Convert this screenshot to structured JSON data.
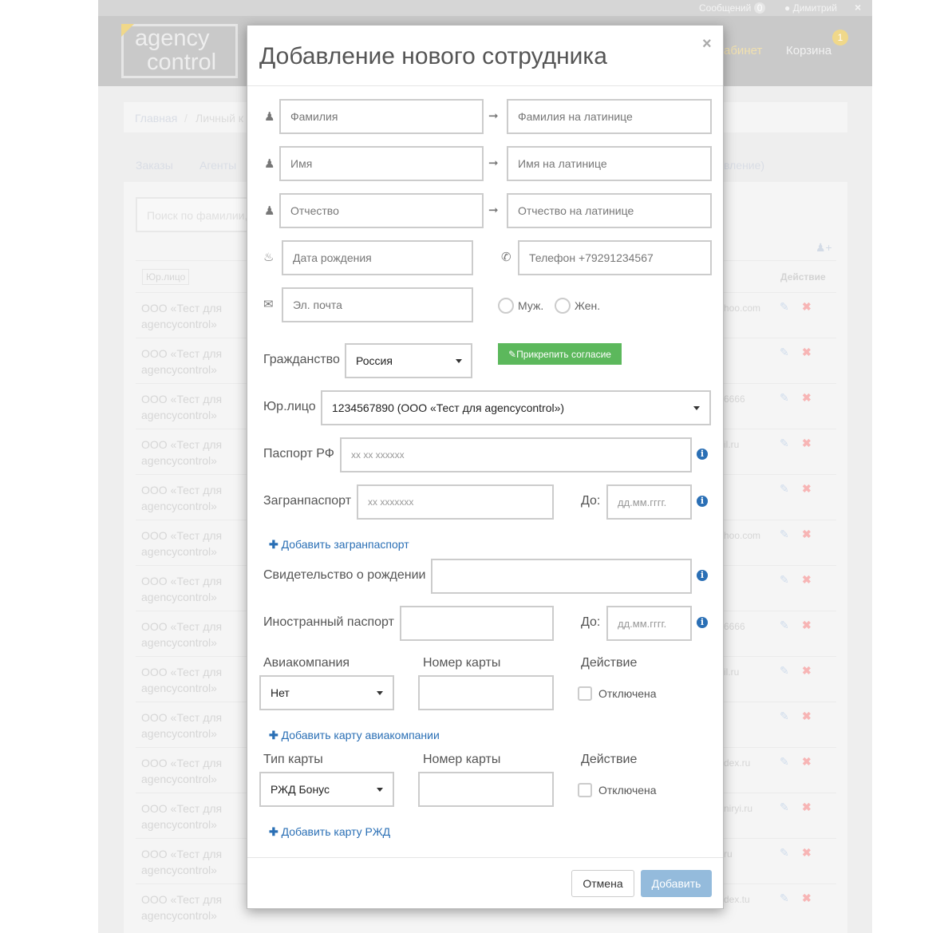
{
  "topbar": {
    "messages_label": "Сообщений",
    "messages_count": "0",
    "user": "Димитрий",
    "close": "×"
  },
  "header": {
    "logo_line1": "agency",
    "logo_line2": "control",
    "nav_cabinet": "абинет",
    "nav_cart": "Корзина",
    "cart_count": "1"
  },
  "breadcrumb": {
    "home": "Главная",
    "separator": "/",
    "current": "Личный к"
  },
  "tabs": [
    "Заказы",
    "Агенты",
    "вление)"
  ],
  "search": {
    "placeholder": "Поиск по фамилии,"
  },
  "table": {
    "filter_label": "Юр.лицо",
    "action_header": "Действие",
    "rows": [
      {
        "company": "ООО «Тест для agencycontrol»",
        "email": "hoo.com"
      },
      {
        "company": "ООО «Тест для agencycontrol»",
        "email": ""
      },
      {
        "company": "ООО «Тест для agencycontrol»",
        "email": "6666"
      },
      {
        "company": "ООО «Тест для agencycontrol»",
        "email": "il.ru"
      },
      {
        "company": "ООО «Тест для agencycontrol»",
        "email": ""
      },
      {
        "company": "ООО «Тест для agencycontrol»",
        "email": "hoo.com"
      },
      {
        "company": "ООО «Тест для agencycontrol»",
        "email": ""
      },
      {
        "company": "ООО «Тест для agencycontrol»",
        "email": "6666"
      },
      {
        "company": "ООО «Тест для agencycontrol»",
        "email": "il.ru"
      },
      {
        "company": "ООО «Тест для agencycontrol»",
        "email": ""
      },
      {
        "company": "ООО «Тест для agencycontrol»",
        "email": "dex.ru"
      },
      {
        "company": "ООО «Тест для agencycontrol»",
        "email": "niryi.ru"
      },
      {
        "company": "ООО «Тест для agencycontrol»",
        "email": "ru"
      },
      {
        "company": "ООО «Тест для agencycontrol»",
        "email": "dex.tu"
      }
    ]
  },
  "modal": {
    "title": "Добавление нового сотрудника",
    "close": "×",
    "last_name": {
      "placeholder": "Фамилия",
      "latin_placeholder": "Фамилия на латинице"
    },
    "first_name": {
      "placeholder": "Имя",
      "latin_placeholder": "Имя на латинице"
    },
    "middle_name": {
      "placeholder": "Отчество",
      "latin_placeholder": "Отчество на латинице"
    },
    "birth_date": {
      "placeholder": "Дата рождения"
    },
    "phone": {
      "placeholder": "Телефон +79291234567"
    },
    "email": {
      "placeholder": "Эл. почта"
    },
    "gender": {
      "male": "Муж.",
      "female": "Жен."
    },
    "citizenship": {
      "label": "Гражданство",
      "value": "Россия"
    },
    "attach_consent": "Прикрепить согласие",
    "legal_entity": {
      "label": "Юр.лицо",
      "value": "1234567890 (ООО «Тест для agencycontrol»)"
    },
    "passport_rf": {
      "label": "Паспорт РФ",
      "placeholder": "xx xx xxxxxx"
    },
    "intl_passport": {
      "label": "Загранпаспорт",
      "placeholder": "xx xxxxxxx",
      "until_label": "До:",
      "until_placeholder": "дд.мм.гггг."
    },
    "add_intl_passport": "Добавить загранпаспорт",
    "birth_cert": {
      "label": "Свидетельство о рождении"
    },
    "foreign_passport": {
      "label": "Иностранный паспорт",
      "until_label": "До:",
      "until_placeholder": "дд.мм.гггг."
    },
    "airline": {
      "label": "Авиакомпания",
      "value": "Нет",
      "card_label": "Номер карты",
      "action_label": "Действие",
      "disabled_label": "Отключена"
    },
    "add_airline_card": "Добавить карту авиакомпании",
    "rail": {
      "label": "Тип карты",
      "value": "РЖД Бонус",
      "card_label": "Номер карты",
      "action_label": "Действие",
      "disabled_label": "Отключена"
    },
    "add_rail_card": "Добавить карту РЖД",
    "cancel": "Отмена",
    "submit": "Добавить"
  },
  "colors": {
    "accent": "#2a6fb5",
    "success": "#5cb85c",
    "submit_disabled": "#94bbdc",
    "logo_accent": "#f0d88a"
  }
}
